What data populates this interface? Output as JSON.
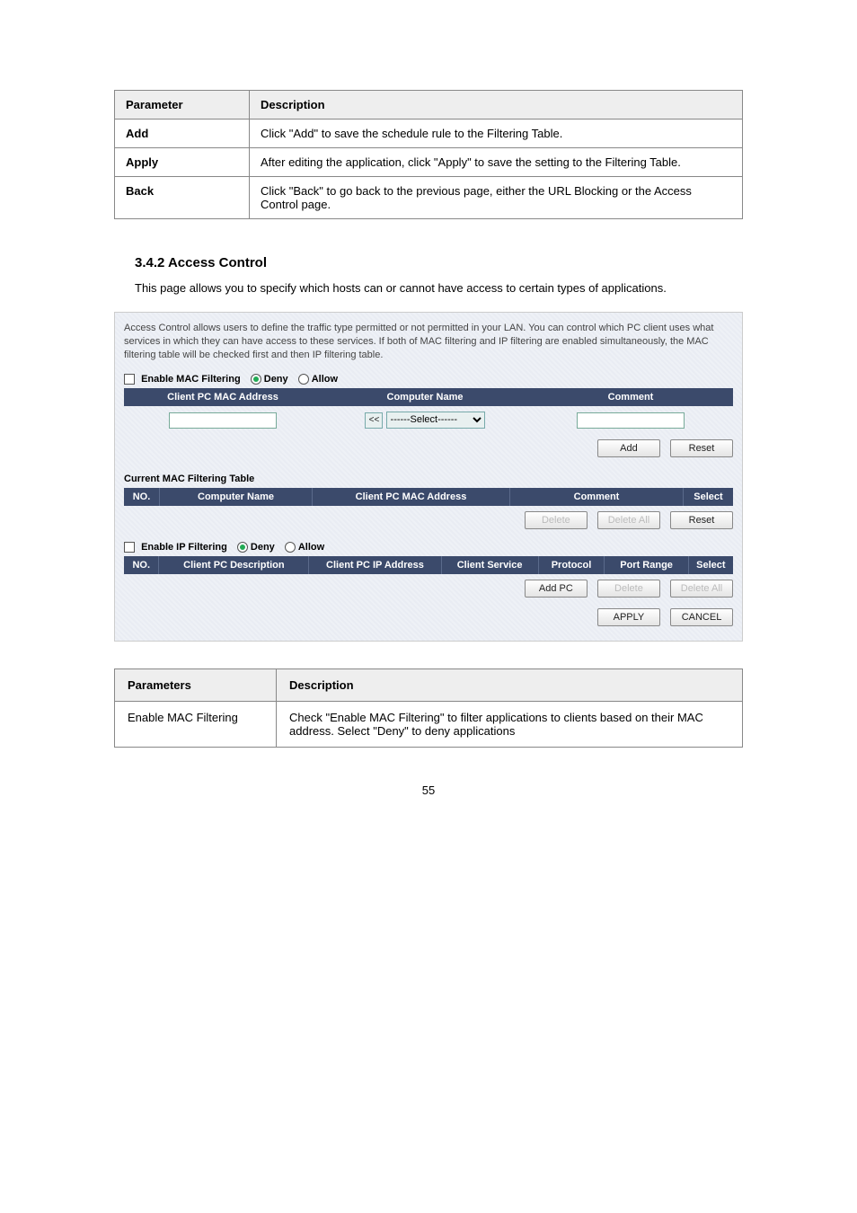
{
  "table1": {
    "rows": [
      {
        "p": "Parameter",
        "d": "Description"
      },
      {
        "p": "Add",
        "d": "Click \"Add\" to save the schedule rule to the Filtering Table."
      },
      {
        "p": "Apply",
        "d": "After editing the application, click \"Apply\" to save the setting to the Filtering Table."
      },
      {
        "p": "Back",
        "d": "Click \"Back\" to go back to the previous page, either the URL Blocking or the Access Control page."
      }
    ]
  },
  "section1": {
    "title": "3.4.2 Access Control",
    "desc": "This page allows you to specify which hosts can or cannot have access to certain types of applications."
  },
  "ui": {
    "introText": "Access Control allows users to define the traffic type permitted or not permitted in your LAN. You can control which PC client uses what services in which they can have access to these services. If both of MAC filtering and IP filtering are enabled simultaneously, the MAC filtering table will be checked first and then IP filtering table.",
    "enableMac": "Enable MAC Filtering",
    "deny": "Deny",
    "allow": "Allow",
    "macCol1": "Client PC MAC Address",
    "macCol2": "Computer Name",
    "macCol3": "Comment",
    "selOpt": "------Select------",
    "back": "<<",
    "add": "Add",
    "reset": "Reset",
    "curMac": "Current MAC Filtering Table",
    "tblNo": "NO.",
    "tblCname": "Computer Name",
    "tblCmac": "Client PC MAC Address",
    "tblComment": "Comment",
    "tblSelect": "Select",
    "delete": "Delete",
    "deleteAll": "Delete All",
    "enableIp": "Enable IP Filtering",
    "ipDesc": "Client PC Description",
    "ipIp": "Client PC IP Address",
    "ipSvc": "Client Service",
    "ipProto": "Protocol",
    "ipRange": "Port Range",
    "addPc": "Add PC",
    "apply": "APPLY",
    "cancel": "CANCEL"
  },
  "table2": {
    "hdr": {
      "p": "Parameters",
      "d": "Description"
    },
    "row": {
      "p": "Enable MAC Filtering",
      "d": "Check \"Enable MAC Filtering\" to filter applications to clients based on their MAC address. Select \"Deny\" to deny applications"
    }
  },
  "pageNum": "55"
}
